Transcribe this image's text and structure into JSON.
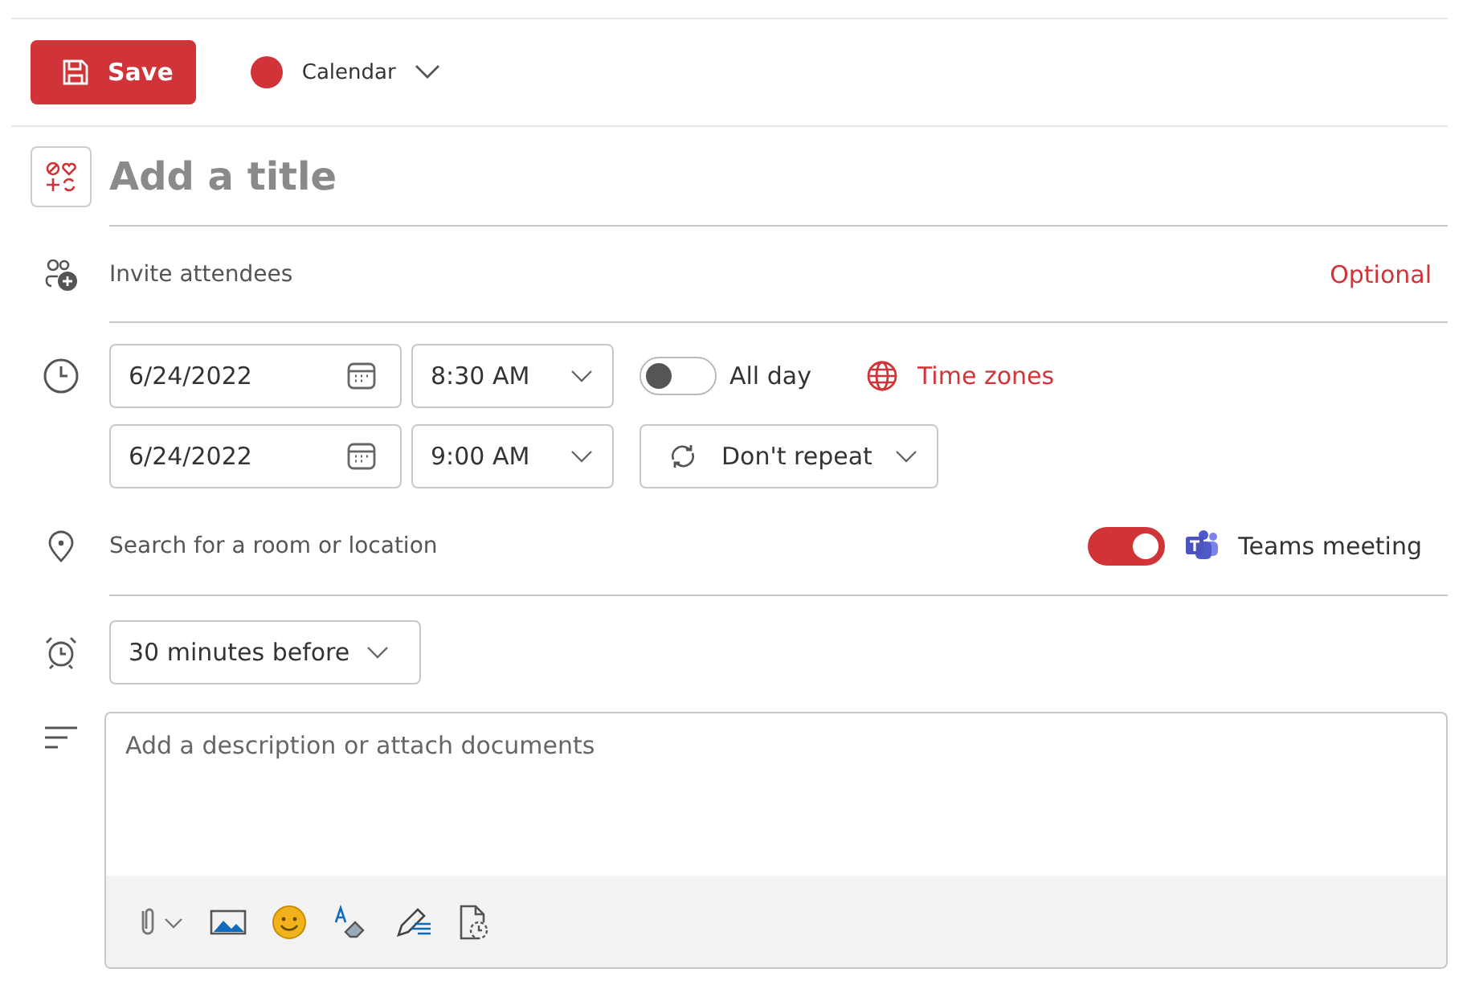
{
  "toolbar": {
    "save": "Save",
    "calendar": {
      "label": "Calendar",
      "color": "#d13438"
    }
  },
  "title": {
    "placeholder": "Add a title"
  },
  "attendees": {
    "placeholder": "Invite attendees",
    "optional": "Optional"
  },
  "start": {
    "date": "6/24/2022",
    "time": "8:30 AM"
  },
  "end": {
    "date": "6/24/2022",
    "time": "9:00 AM"
  },
  "all_day": {
    "label": "All day",
    "on": false
  },
  "time_zones": "Time zones",
  "repeat": "Don't repeat",
  "location": {
    "placeholder": "Search for a room or location"
  },
  "teams": {
    "label": "Teams meeting",
    "on": true
  },
  "reminder": "30 minutes before",
  "description": {
    "placeholder": "Add a description or attach documents"
  }
}
